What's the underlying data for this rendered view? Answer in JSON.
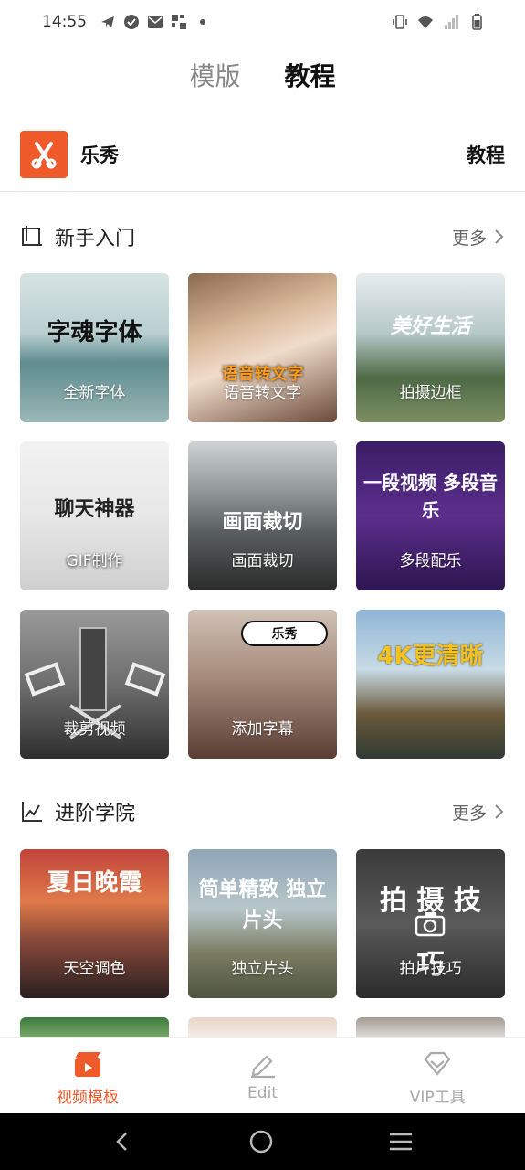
{
  "status": {
    "time": "14:55"
  },
  "top_tabs": [
    {
      "label": "模版",
      "active": false
    },
    {
      "label": "教程",
      "active": true
    }
  ],
  "brand": {
    "name": "乐秀",
    "right_label": "教程"
  },
  "sections": [
    {
      "title": "新手入门",
      "more": "更多",
      "cards": [
        {
          "label": "全新字体",
          "art": "字魂字体"
        },
        {
          "label": "语音转文字",
          "art": "语音转文字"
        },
        {
          "label": "拍摄边框",
          "art": "美好生活"
        },
        {
          "label": "GIF制作",
          "art": "聊天神器"
        },
        {
          "label": "画面裁切",
          "art": "画面裁切"
        },
        {
          "label": "多段配乐",
          "art": "一段视频 多段音乐"
        },
        {
          "label": "裁剪视频",
          "art": ""
        },
        {
          "label": "添加字幕",
          "art": "乐秀"
        },
        {
          "label": "",
          "art": "4K更清晰"
        }
      ]
    },
    {
      "title": "进阶学院",
      "more": "更多",
      "cards": [
        {
          "label": "天空调色",
          "art": "夏日晚霞"
        },
        {
          "label": "独立片头",
          "art": "简单精致 独立片头"
        },
        {
          "label": "拍片技巧",
          "art": "拍 摄 技 巧"
        }
      ]
    }
  ],
  "bottom_nav": [
    {
      "label": "视频模板",
      "active": true
    },
    {
      "label": "Edit",
      "active": false
    },
    {
      "label": "VIP工具",
      "active": false
    }
  ],
  "colors": {
    "accent": "#ef5a2a"
  }
}
